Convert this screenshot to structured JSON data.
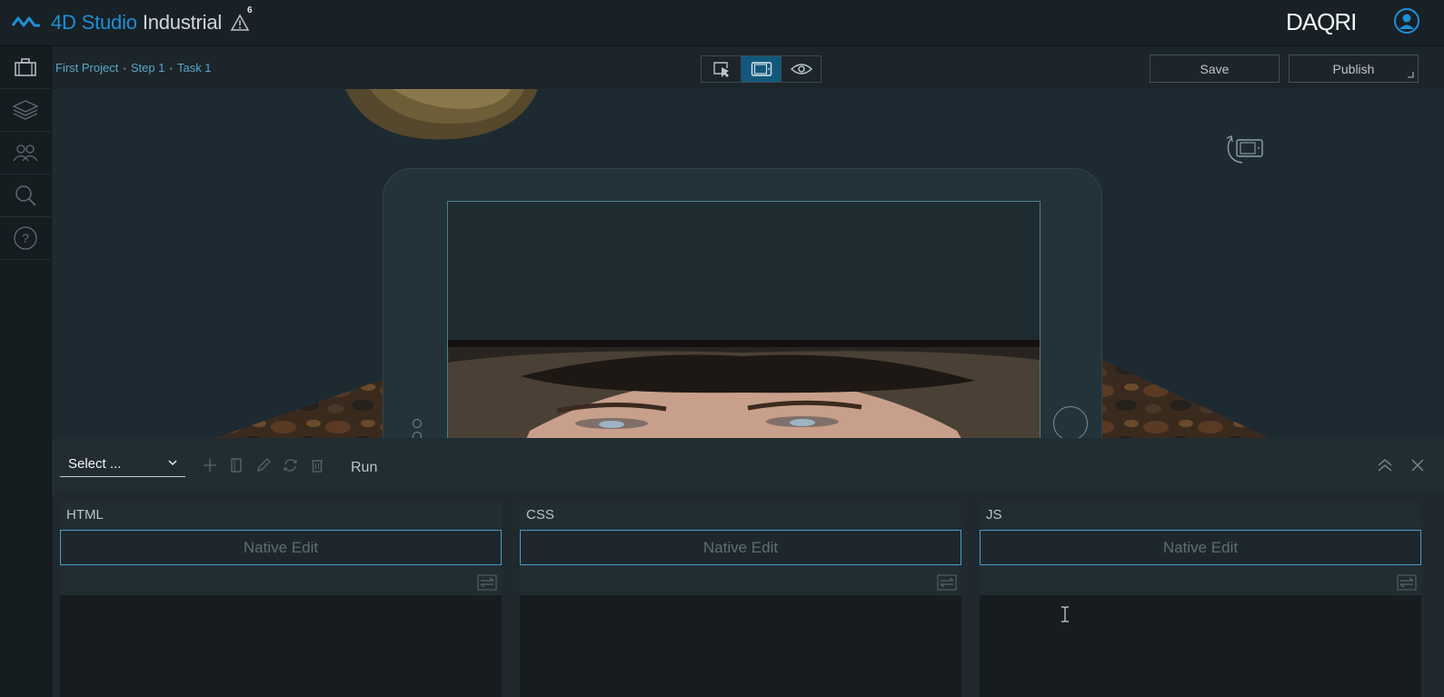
{
  "app": {
    "brand": "4D Studio",
    "product": "Industrial",
    "alert_count": "6",
    "company": "DAQRI"
  },
  "sidebar": {
    "items": [
      {
        "icon": "briefcase-icon"
      },
      {
        "icon": "layers-icon"
      },
      {
        "icon": "users-icon"
      },
      {
        "icon": "search-icon"
      },
      {
        "icon": "help-icon"
      }
    ]
  },
  "breadcrumb": {
    "project": "First Project",
    "step": "Step 1",
    "task": "Task 1",
    "separator": "•"
  },
  "modes": [
    "select-mode-icon",
    "device-view-icon",
    "preview-eye-icon"
  ],
  "actions": {
    "save_label": "Save",
    "publish_label": "Publish"
  },
  "editor": {
    "select_value": "Select ...",
    "run_label": "Run",
    "panels": [
      {
        "title": "HTML",
        "native_edit_label": "Native Edit"
      },
      {
        "title": "CSS",
        "native_edit_label": "Native Edit"
      },
      {
        "title": "JS",
        "native_edit_label": "Native Edit"
      }
    ]
  },
  "colors": {
    "accent": "#1e8fd8",
    "active_mode": "#12587c",
    "background": "#1b2327"
  }
}
